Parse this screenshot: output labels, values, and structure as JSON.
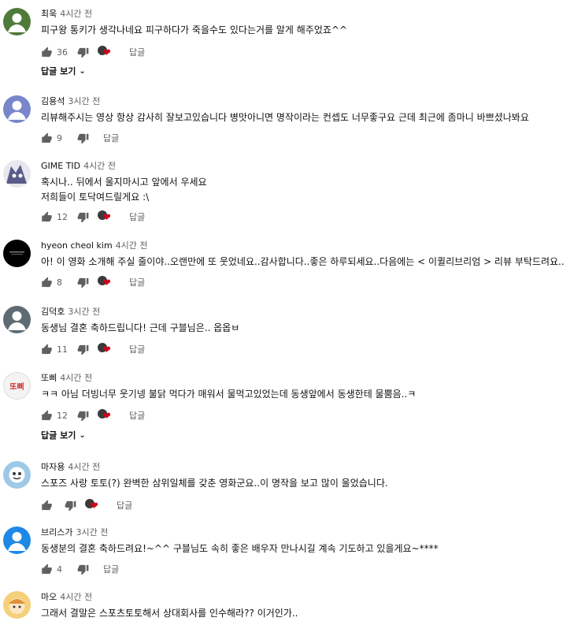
{
  "comments": [
    {
      "author": "최욱",
      "time": "4시간 전",
      "avatar_color": "#4f7b3a",
      "lines": [
        "피구왕 통키가 생각나네요 피구하다가 죽을수도 있다는거를 알게 해주었죠^^"
      ],
      "likes": "36",
      "creator_heart": true,
      "reply_label": "답글",
      "view_replies": "답글 보기"
    },
    {
      "author": "김용석",
      "time": "3시간 전",
      "avatar_color": "#7986cb",
      "lines": [
        "리뷰해주시는 영상 항상 감사히 잘보고있습니다 병맛아니면 명작이라는 컨셉도 너무좋구요 근데  최근에 좀마니 바쁘셨나봐요"
      ],
      "likes": "9",
      "creator_heart": false,
      "reply_label": "답글"
    },
    {
      "author": "GIME TID",
      "time": "4시간 전",
      "avatar_color": "#5b5b8a",
      "lines": [
        "혹시나.. 뒤에서 울지마시고 앞에서 우세요",
        "저희들이 토닥여드릴게요 :\\"
      ],
      "likes": "12",
      "creator_heart": true,
      "reply_label": "답글"
    },
    {
      "author": "hyeon cheol kim",
      "time": "4시간 전",
      "avatar_color": "#000000",
      "lines": [
        "아! 이 영화 소개해 주실 줄이야..오랜만에 또 웃었네요..감사합니다..좋은 하루되세요..다음에는 < 이퀼리브리엄 > 리뷰 부탁드려요.."
      ],
      "likes": "8",
      "creator_heart": true,
      "reply_label": "답글"
    },
    {
      "author": "김덕호",
      "time": "3시간 전",
      "avatar_color": "#5f6b73",
      "lines": [
        "동생님 결혼 축하드립니다! 근데 구블님은.. 옵옵ㅂ"
      ],
      "likes": "11",
      "creator_heart": true,
      "reply_label": "답글"
    },
    {
      "author": "또삐",
      "time": "4시간 전",
      "avatar_color": "#f3f3f3",
      "avatar_text": "또삐",
      "lines": [
        "ㅋㅋ 아님 더빙너무 웃기넹 불닭 먹다가 매워서 물먹고있었는데 동생앞에서 동생한테 물뿜음..ㅋ"
      ],
      "likes": "12",
      "creator_heart": true,
      "reply_label": "답글",
      "view_replies": "답글 보기"
    },
    {
      "author": "마자용",
      "time": "4시간 전",
      "avatar_color": "#9ec9e6",
      "lines": [
        "스포즈 사랑 토토(?) 완벽한 삼위일체를 갖춘 영화군요..이 명작을 보고 많이 울었습니다."
      ],
      "likes": "",
      "creator_heart": true,
      "reply_label": "답글"
    },
    {
      "author": "브리스가",
      "time": "3시간 전",
      "avatar_color": "#1e88e5",
      "lines": [
        "동생분의 결혼 축하드려요!~^^ 구블님도 속히 좋은 배우자 만나시길 계속 기도하고 있을게요~****"
      ],
      "likes": "4",
      "creator_heart": false,
      "reply_label": "답글"
    },
    {
      "author": "마오",
      "time": "4시간 전",
      "avatar_color": "#f5cf7a",
      "lines": [
        "그래서 결말은 스포츠토토해서 상대회사를 인수해라?? 이거인가.."
      ],
      "likes": "",
      "creator_heart": false,
      "reply_label": "답글"
    }
  ]
}
